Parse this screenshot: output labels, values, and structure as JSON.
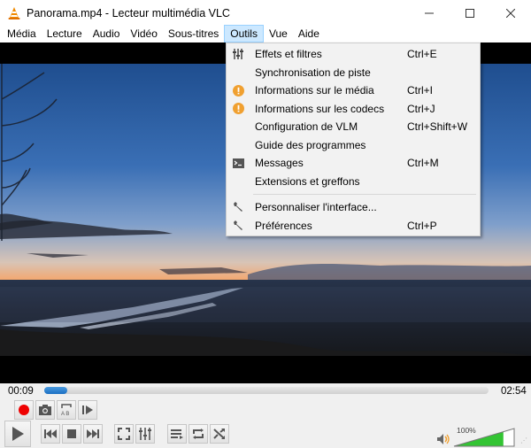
{
  "window": {
    "title": "Panorama.mp4 - Lecteur multimédia VLC",
    "app_icon": "vlc-cone-icon",
    "controls": [
      "minimize",
      "maximize",
      "close"
    ]
  },
  "menubar": {
    "items": [
      {
        "label": "Média",
        "mnemonic": "M"
      },
      {
        "label": "Lecture",
        "mnemonic": "L"
      },
      {
        "label": "Audio",
        "mnemonic": "A"
      },
      {
        "label": "Vidéo",
        "mnemonic": "V"
      },
      {
        "label": "Sous-titres",
        "mnemonic": "t"
      },
      {
        "label": "Outils",
        "mnemonic": "O",
        "active": true
      },
      {
        "label": "Vue",
        "mnemonic": "u"
      },
      {
        "label": "Aide",
        "mnemonic": "i"
      }
    ]
  },
  "tools_menu": {
    "items": [
      {
        "label": "Effets et filtres",
        "shortcut": "Ctrl+E",
        "icon": "equalizer-icon"
      },
      {
        "label": "Synchronisation de piste",
        "shortcut": "",
        "icon": ""
      },
      {
        "label": "Informations sur le média",
        "shortcut": "Ctrl+I",
        "icon": "info-icon"
      },
      {
        "label": "Informations sur les codecs",
        "shortcut": "Ctrl+J",
        "icon": "info-icon"
      },
      {
        "label": "Configuration de VLM",
        "shortcut": "Ctrl+Shift+W",
        "icon": ""
      },
      {
        "label": "Guide des programmes",
        "shortcut": "",
        "icon": ""
      },
      {
        "label": "Messages",
        "shortcut": "Ctrl+M",
        "icon": "terminal-icon"
      },
      {
        "label": "Extensions et greffons",
        "shortcut": "",
        "icon": ""
      },
      {
        "separator": true
      },
      {
        "label": "Personnaliser l'interface...",
        "shortcut": "",
        "icon": "wrench-icon"
      },
      {
        "label": "Préférences",
        "shortcut": "Ctrl+P",
        "icon": "wrench-icon"
      }
    ]
  },
  "player": {
    "elapsed": "00:09",
    "duration": "02:54",
    "progress_fraction": 0.052,
    "volume_label": "100%",
    "volume_fraction": 0.82,
    "colors": {
      "seek_fill": "#1c6fc2",
      "record": "#ee0000",
      "volume_fill": "#33c433",
      "info_icon": "#f0a030"
    }
  }
}
